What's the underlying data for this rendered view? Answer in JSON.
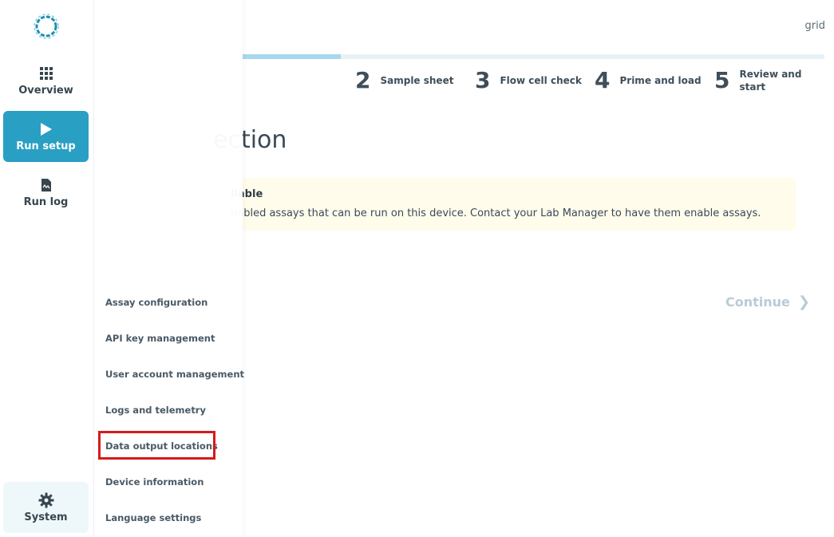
{
  "header": {
    "user": "grid"
  },
  "sidebar": {
    "items": [
      {
        "label": "Overview",
        "icon": "grid-icon"
      },
      {
        "label": "Run setup",
        "icon": "play-icon"
      },
      {
        "label": "Run log",
        "icon": "file-icon"
      }
    ],
    "system": {
      "label": "System",
      "icon": "gear-icon"
    }
  },
  "progress": {
    "fraction": 0.17
  },
  "steps": [
    {
      "num": "2",
      "line1": "Sample sheet",
      "line2": ""
    },
    {
      "num": "3",
      "line1": "Flow cell check",
      "line2": ""
    },
    {
      "num": "4",
      "line1": "Prime and load",
      "line2": ""
    },
    {
      "num": "5",
      "line1": "Review and",
      "line2": "start"
    }
  ],
  "main": {
    "title": "ection",
    "alert_title": "ilable",
    "alert_body": "nabled assays that can be run on this device. Contact your Lab Manager to have them enable assays.",
    "continue_label": "Continue"
  },
  "system_menu": {
    "items": [
      "Assay configuration",
      "API key management",
      "User account management",
      "Logs and telemetry",
      "Data output locations",
      "Device information",
      "Language settings"
    ]
  },
  "colors": {
    "accent": "#2a9fc4",
    "highlight": "#d7191c"
  }
}
